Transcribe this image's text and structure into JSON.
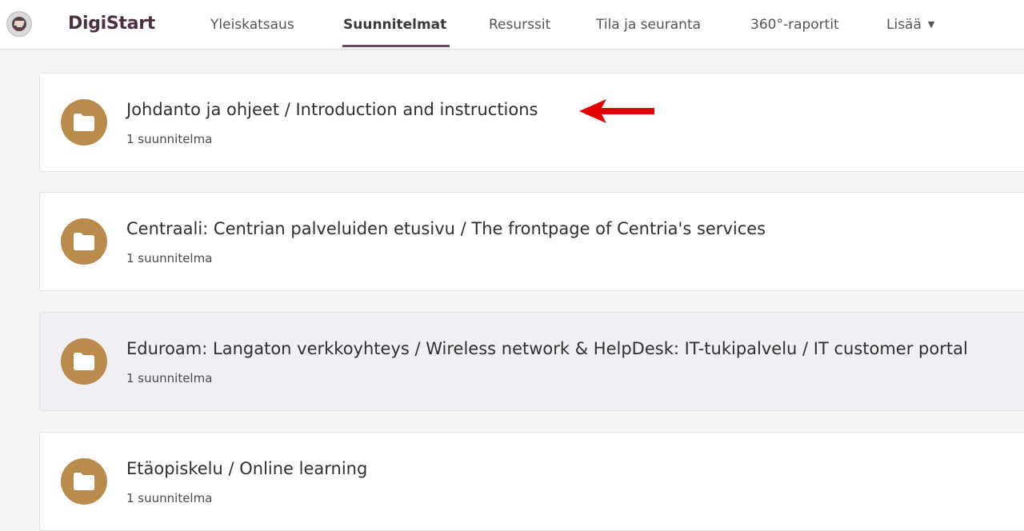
{
  "header": {
    "brand": "DigiStart",
    "nav": [
      {
        "label": "Yleiskatsaus",
        "active": false
      },
      {
        "label": "Suunnitelmat",
        "active": true
      },
      {
        "label": "Resurssit",
        "active": false
      },
      {
        "label": "Tila ja seuranta",
        "active": false
      },
      {
        "label": "360°-raportit",
        "active": false
      },
      {
        "label": "Lisää",
        "active": false
      }
    ],
    "more_icon": "caret-down-icon"
  },
  "folders": [
    {
      "title": "Johdanto ja ohjeet / Introduction and instructions",
      "count": "1 suunnitelma",
      "icon": "folder-icon"
    },
    {
      "title": "Centraali: Centrian palveluiden etusivu / The frontpage of Centria's services",
      "count": "1 suunnitelma",
      "icon": "folder-icon"
    },
    {
      "title": "Eduroam: Langaton verkkoyhteys / Wireless network & HelpDesk: IT-tukipalvelu / IT customer portal",
      "count": "1 suunnitelma",
      "icon": "folder-icon"
    },
    {
      "title": "Etäopiskelu / Online learning",
      "count": "1 suunnitelma",
      "icon": "folder-icon"
    }
  ],
  "colors": {
    "brand": "#4d2f44",
    "accent_underline": "#6b4b61",
    "folder_badge": "#b98b4c",
    "annotation_arrow": "#e50000",
    "hover_card": "#f1eff4"
  }
}
